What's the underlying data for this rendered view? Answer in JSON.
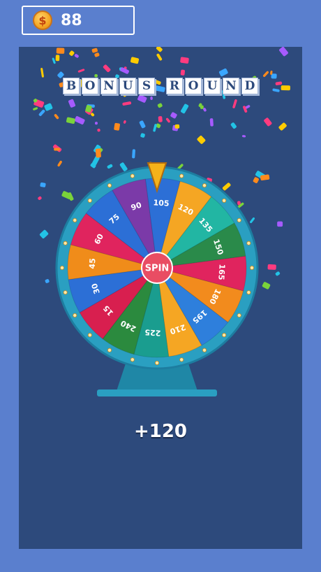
{
  "hud": {
    "coins": "88",
    "coin_symbol": "$"
  },
  "title": "BONUS ROUND",
  "wheel": {
    "segments": [
      "105",
      "120",
      "135",
      "150",
      "165",
      "180",
      "195",
      "210",
      "225",
      "240",
      "15",
      "30",
      "45",
      "60",
      "75",
      "90"
    ],
    "colors": [
      "#2c6fd6",
      "#f5a623",
      "#22b6a3",
      "#2a8a4a",
      "#e0245e",
      "#f28b1d",
      "#2e7fdc",
      "#f5a623",
      "#1a9d8f",
      "#2b8a3e",
      "#d81f4f",
      "#2c6fd6",
      "#f08c1a",
      "#e0245e",
      "#2c6fd6",
      "#7b3aa8"
    ],
    "spin_label": "SPIN",
    "rim_color": "#2a9fc1"
  },
  "reward": "+120",
  "colors": {
    "background": "#5a7fce",
    "panel": "#2d4a7c"
  }
}
